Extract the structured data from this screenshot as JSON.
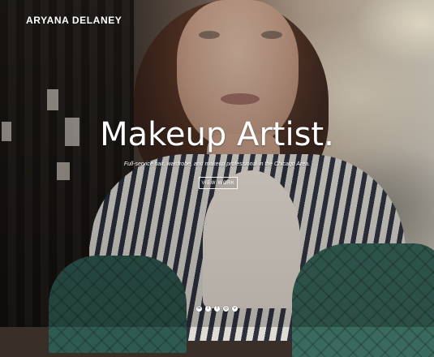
{
  "site": {
    "brand": "ARYANA DELANEY"
  },
  "hero": {
    "headline": "Makeup Artist.",
    "subline": "Full-service hair, wardrobe, and makeup professional in the Chicago Area.",
    "cta_label": "VIEW WORK"
  },
  "social": {
    "items": [
      {
        "name": "email",
        "glyph": "✉"
      },
      {
        "name": "twitter",
        "glyph": "t"
      },
      {
        "name": "facebook",
        "glyph": "f"
      },
      {
        "name": "instagram",
        "glyph": "◎"
      },
      {
        "name": "vimeo",
        "glyph": "v"
      }
    ]
  }
}
